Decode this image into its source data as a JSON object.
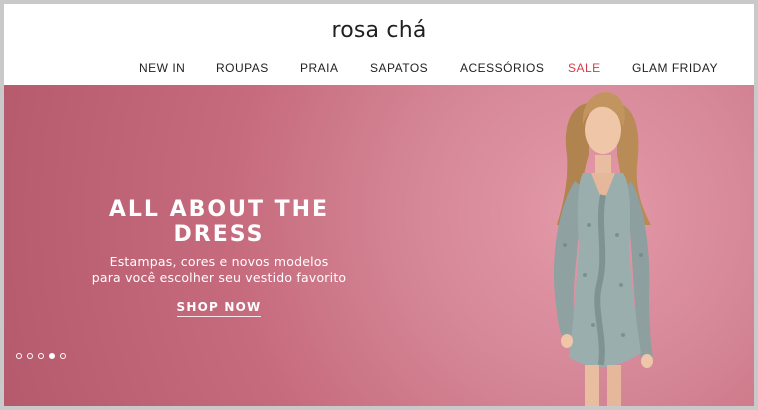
{
  "brand": {
    "name": "rosa chá"
  },
  "nav": {
    "items": [
      {
        "label": "NEW IN"
      },
      {
        "label": "ROUPAS"
      },
      {
        "label": "PRAIA"
      },
      {
        "label": "SAPATOS"
      },
      {
        "label": "ACESSÓRIOS"
      },
      {
        "label": "SALE"
      },
      {
        "label": "GLAM FRIDAY"
      }
    ],
    "sale_color": "#d63a47"
  },
  "hero": {
    "headline": "ALL ABOUT THE DRESS",
    "subtitle_line1": "Estampas, cores e novos modelos",
    "subtitle_line2": "para você escolher seu vestido favorito",
    "cta_label": "SHOP NOW",
    "background_color": "#c66b7d",
    "carousel": {
      "total": 5,
      "active_index": 3
    }
  }
}
